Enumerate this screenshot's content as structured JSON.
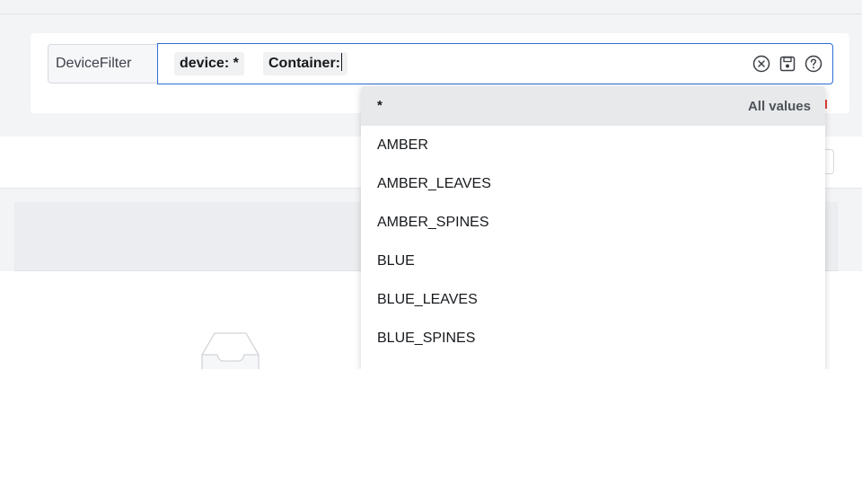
{
  "filter": {
    "label": "DeviceFilter",
    "chips": [
      "device: *",
      "Container:"
    ],
    "icons": [
      "clear-circle-icon",
      "save-icon",
      "help-icon"
    ]
  },
  "dropdown": {
    "header_value": "*",
    "header_hint": "All values",
    "items": [
      "AMBER",
      "AMBER_LEAVES",
      "AMBER_SPINES",
      "BLUE",
      "BLUE_LEAVES",
      "BLUE_SPINES"
    ]
  },
  "colors": {
    "focus_border": "#2d6fd6",
    "page_background": "#f3f4f6",
    "accent_red": "#e0413a"
  }
}
